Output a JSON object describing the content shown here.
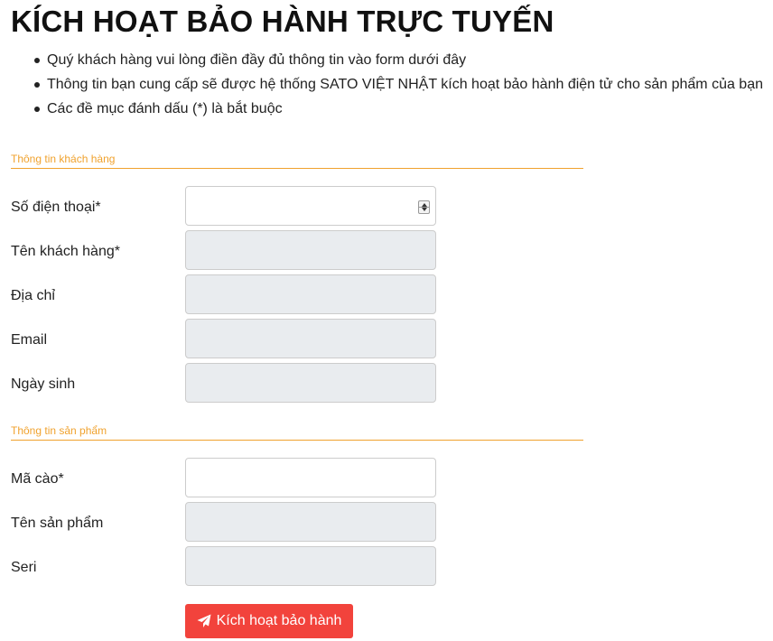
{
  "header": {
    "title": "KÍCH HOẠT BẢO HÀNH TRỰC TUYẾN",
    "bullets": [
      "Quý khách hàng vui lòng điền đầy đủ thông tin vào form dưới đây",
      "Thông tin bạn cung cấp sẽ được hệ thống SATO VIỆT NHẬT kích hoạt bảo hành điện tử cho sản phẩm của bạn",
      "Các đề mục đánh dấu (*) là bắt buộc"
    ]
  },
  "customer_section": {
    "legend": "Thông tin khách hàng",
    "fields": {
      "phone": {
        "label": "Số điện thoại*",
        "value": ""
      },
      "name": {
        "label": "Tên khách hàng*",
        "value": ""
      },
      "address": {
        "label": "Địa chỉ",
        "value": ""
      },
      "email": {
        "label": "Email",
        "value": ""
      },
      "birthday": {
        "label": "Ngày sinh",
        "value": ""
      }
    }
  },
  "product_section": {
    "legend": "Thông tin sản phẩm",
    "fields": {
      "scratch_code": {
        "label": "Mã cào*",
        "value": ""
      },
      "product_name": {
        "label": "Tên sản phẩm",
        "value": ""
      },
      "serial": {
        "label": "Seri",
        "value": ""
      }
    }
  },
  "actions": {
    "submit_label": "Kích hoạt bảo hành",
    "submit_icon": "paper-plane-icon"
  },
  "colors": {
    "accent": "#f0a22e",
    "button": "#f2433c",
    "disabled_field": "#e9ecef"
  }
}
